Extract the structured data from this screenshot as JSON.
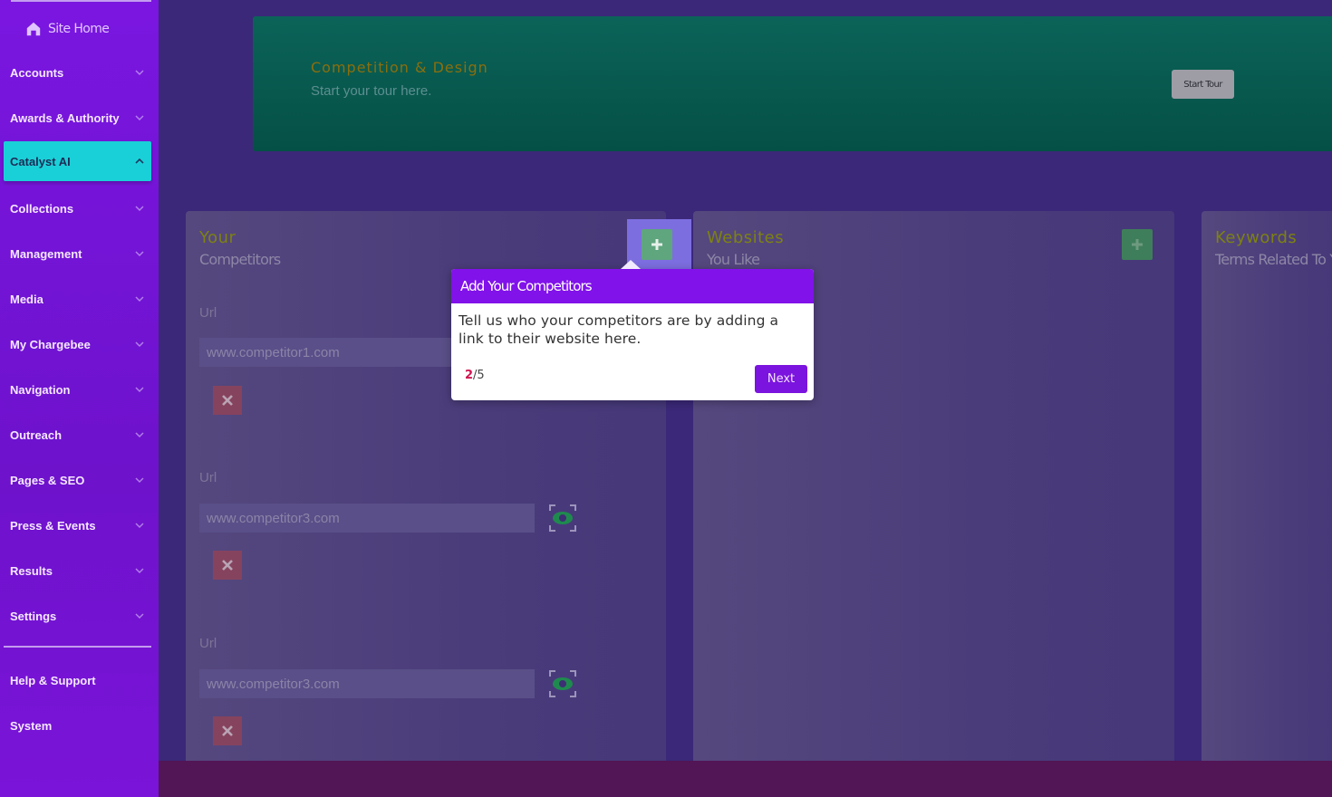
{
  "sidebar": {
    "site_home": "Site Home",
    "items": [
      {
        "label": "Accounts",
        "expanded": false
      },
      {
        "label": "Awards & Authority",
        "expanded": false
      },
      {
        "label": "Catalyst AI",
        "expanded": true,
        "active": true
      },
      {
        "label": "Collections",
        "expanded": false
      },
      {
        "label": "Management",
        "expanded": false
      },
      {
        "label": "Media",
        "expanded": false
      },
      {
        "label": "My Chargebee",
        "expanded": false
      },
      {
        "label": "Navigation",
        "expanded": false
      },
      {
        "label": "Outreach",
        "expanded": false
      },
      {
        "label": "Pages & SEO",
        "expanded": false
      },
      {
        "label": "Press & Events",
        "expanded": false
      },
      {
        "label": "Results",
        "expanded": false
      },
      {
        "label": "Settings",
        "expanded": false
      }
    ],
    "footer_items": [
      {
        "label": "Help & Support"
      },
      {
        "label": "System"
      }
    ]
  },
  "hero": {
    "title": "Competition & Design",
    "subtitle": "Start your tour here.",
    "start_tour_label": "Start Tour"
  },
  "cards": {
    "competitors": {
      "title": "Your",
      "subtitle": "Competitors",
      "entries": [
        {
          "label": "Url",
          "value": "www.competitor1.com"
        },
        {
          "label": "Url",
          "value": "www.competitor3.com"
        },
        {
          "label": "Url",
          "value": "www.competitor3.com"
        }
      ]
    },
    "websites": {
      "title": "Websites",
      "subtitle": "You Like"
    },
    "keywords": {
      "title": "Keywords",
      "subtitle": "Terms Related To Yo"
    }
  },
  "tour": {
    "title": "Add Your Competitors",
    "body": "Tell us who your competitors are by adding a link to their website here.",
    "step_current": "2",
    "step_total": "/5",
    "next_label": "Next"
  },
  "colors": {
    "sidebar": "#7a16e0",
    "active_nav": "#1ad0d8",
    "tour_header": "#8112ea",
    "step_highlight": "#d11450"
  }
}
